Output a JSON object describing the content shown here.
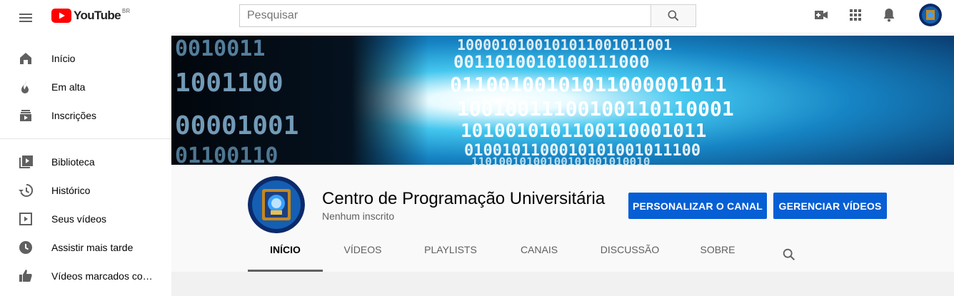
{
  "header": {
    "logo_text": "YouTube",
    "logo_region": "BR",
    "search_placeholder": "Pesquisar",
    "search_value": ""
  },
  "sidebar": {
    "items": [
      {
        "label": "Início",
        "icon": "home-icon"
      },
      {
        "label": "Em alta",
        "icon": "trending-icon"
      },
      {
        "label": "Inscrições",
        "icon": "subscriptions-icon"
      },
      {
        "label": "Biblioteca",
        "icon": "library-icon"
      },
      {
        "label": "Histórico",
        "icon": "history-icon"
      },
      {
        "label": "Seus vídeos",
        "icon": "your-videos-icon"
      },
      {
        "label": "Assistir mais tarde",
        "icon": "watch-later-icon"
      },
      {
        "label": "Vídeos marcados co…",
        "icon": "liked-videos-icon"
      }
    ]
  },
  "channel": {
    "name": "Centro de Programação Universitária",
    "subscribers": "Nenhum inscrito",
    "customize_button": "PERSONALIZAR O CANAL",
    "manage_button": "GERENCIAR VÍDEOS",
    "tabs": [
      "INÍCIO",
      "VÍDEOS",
      "PLAYLISTS",
      "CANAIS",
      "DISCUSSÃO",
      "SOBRE"
    ],
    "active_tab": "INÍCIO"
  },
  "colors": {
    "brand_red": "#ff0000",
    "primary_blue": "#065fd4",
    "banner_cyan": "#40c8f0"
  }
}
